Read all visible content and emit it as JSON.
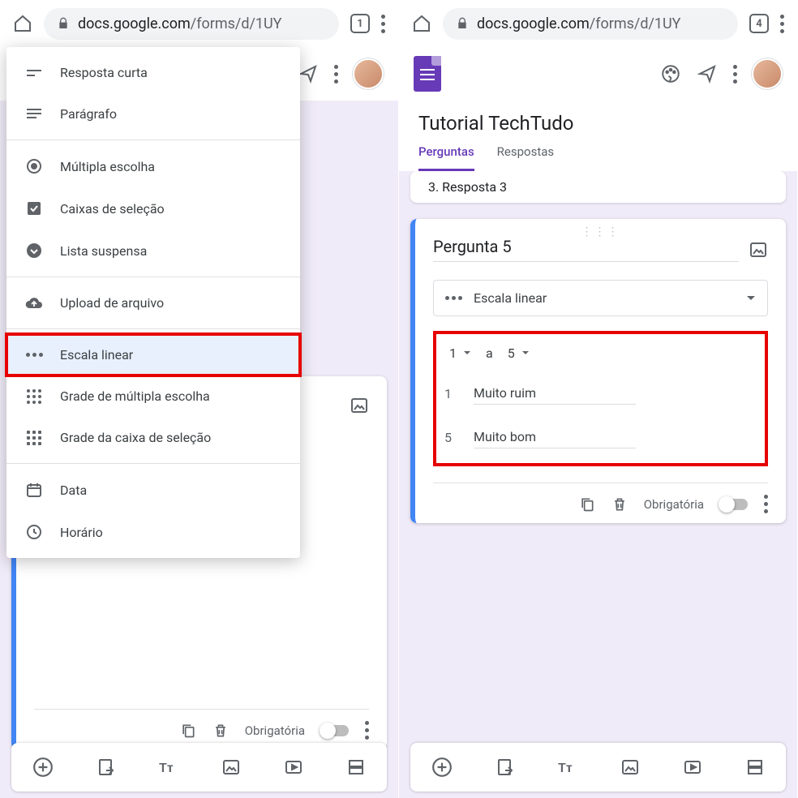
{
  "browser": {
    "url_host": "docs.google.com",
    "url_path": "/forms/d/1UY",
    "tab_count_left": "1",
    "tab_count_right": "4"
  },
  "form": {
    "title": "Tutorial TechTudo",
    "tab_questions": "Perguntas",
    "tab_responses": "Respostas",
    "prev_answer": "3.   Resposta 3"
  },
  "question": {
    "title": "Pergunta 5",
    "type_label": "Escala linear",
    "range_from": "1",
    "range_to": "5",
    "range_conn": "a",
    "label_low_num": "1",
    "label_low": "Muito ruim",
    "label_high_num": "5",
    "label_high": "Muito bom",
    "required_label": "Obrigatória"
  },
  "menu": {
    "short_answer": "Resposta curta",
    "paragraph": "Parágrafo",
    "multiple_choice": "Múltipla escolha",
    "checkboxes": "Caixas de seleção",
    "dropdown": "Lista suspensa",
    "file_upload": "Upload de arquivo",
    "linear_scale": "Escala linear",
    "mc_grid": "Grade de múltipla escolha",
    "cb_grid": "Grade da caixa de seleção",
    "date": "Data",
    "time": "Horário"
  }
}
